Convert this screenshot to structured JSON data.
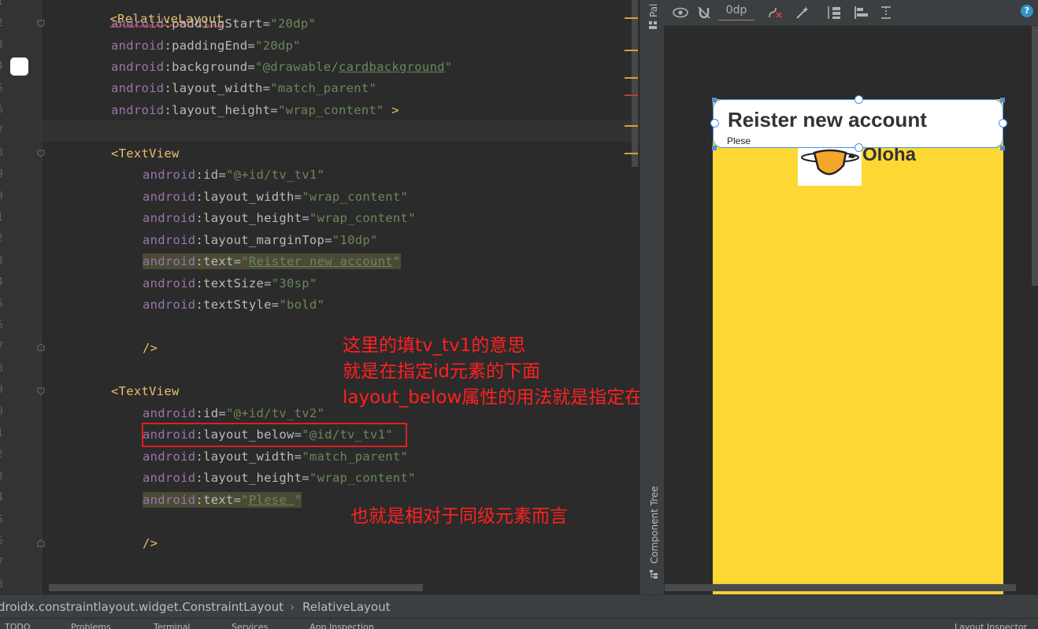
{
  "editor": {
    "line_numbers": [
      "1",
      "2",
      "3",
      "4",
      "5",
      "6",
      "7",
      "8",
      "9",
      "0",
      "1",
      "2",
      "3",
      "4",
      "5",
      "6",
      "7",
      "8",
      "9",
      "0",
      "1",
      "2",
      "3",
      "4",
      "5",
      "6",
      "7",
      "8"
    ],
    "lines": {
      "l1_tag": "<RelativeLayout",
      "l2_ns": "android",
      "l2_attr": ":paddingStart",
      "l2_val": "\"20dp\"",
      "l3_ns": "android",
      "l3_attr": ":paddingEnd",
      "l3_val": "\"20dp\"",
      "l4_ns": "android",
      "l4_attr": ":background",
      "l4_val_a": "\"@drawable/",
      "l4_val_b": "cardbackground",
      "l4_val_c": "\"",
      "l5_ns": "android",
      "l5_attr": ":layout_width",
      "l5_val": "\"match_parent\"",
      "l6_ns": "android",
      "l6_attr": ":layout_height",
      "l6_val": "\"wrap_content\"",
      "l6_end": " >",
      "l8_tag": "<TextView",
      "l9_ns": "android",
      "l9_attr": ":id",
      "l9_val": "\"@+id/tv_tv1\"",
      "l10_ns": "android",
      "l10_attr": ":layout_width",
      "l10_val": "\"wrap_content\"",
      "l11_ns": "android",
      "l11_attr": ":layout_height",
      "l11_val": "\"wrap_content\"",
      "l12_ns": "android",
      "l12_attr": ":layout_marginTop",
      "l12_val": "\"10dp\"",
      "l13_ns": "android",
      "l13_attr": ":text",
      "l13_val_a": "\"",
      "l13_val_b": "Reister new account",
      "l13_val_c": "\"",
      "l14_ns": "android",
      "l14_attr": ":textSize",
      "l14_val": "\"30sp\"",
      "l15_ns": "android",
      "l15_attr": ":textStyle",
      "l15_val": "\"bold\"",
      "l17_tag": "/>",
      "l19_tag": "<TextView",
      "l20_ns": "android",
      "l20_attr": ":id",
      "l20_val": "\"@+id/tv_tv2\"",
      "l21_ns": "android",
      "l21_attr": ":layout_below",
      "l21_val": "\"@id/tv_tv1\"",
      "l22_ns": "android",
      "l22_attr": ":layout_width",
      "l22_val": "\"match_parent\"",
      "l23_ns": "android",
      "l23_attr": ":layout_height",
      "l23_val": "\"wrap_content\"",
      "l24_ns": "android",
      "l24_attr": ":text",
      "l24_val_a": "\"",
      "l24_val_b": "Plese ",
      "l24_val_c": "\"",
      "l26_tag": "/>"
    },
    "annotations": {
      "note1_line1": "这里的填tv_tv1的意思",
      "note1_line2": "就是在指定id元素的下面",
      "note1_line3": "layout_below属性的用法就是指定在谁的下面",
      "note2": "也就是相对于同级元素而言"
    }
  },
  "side_strip": {
    "palette_label": "Pal",
    "component_tree_label": "Component Tree"
  },
  "design_toolbar": {
    "margin_value": "0dp",
    "icons": [
      "eye-icon",
      "magnet-off-icon",
      "clear-constraints-icon",
      "magic-wand-icon",
      "pack-icon",
      "align-icon",
      "guidelines-icon",
      "help-icon"
    ]
  },
  "preview": {
    "title": "Reister new account",
    "subtitle": "Plese",
    "brand": "Oloha",
    "background_color": "#fdd835"
  },
  "breadcrumb": {
    "item1": "droidx.constraintlayout.widget.ConstraintLayout",
    "separator": "›",
    "item2": "RelativeLayout"
  },
  "statusbar": {
    "items": [
      "TODO",
      "Problems",
      "Terminal",
      "Services",
      "App Inspection",
      "Layout Inspector"
    ]
  }
}
